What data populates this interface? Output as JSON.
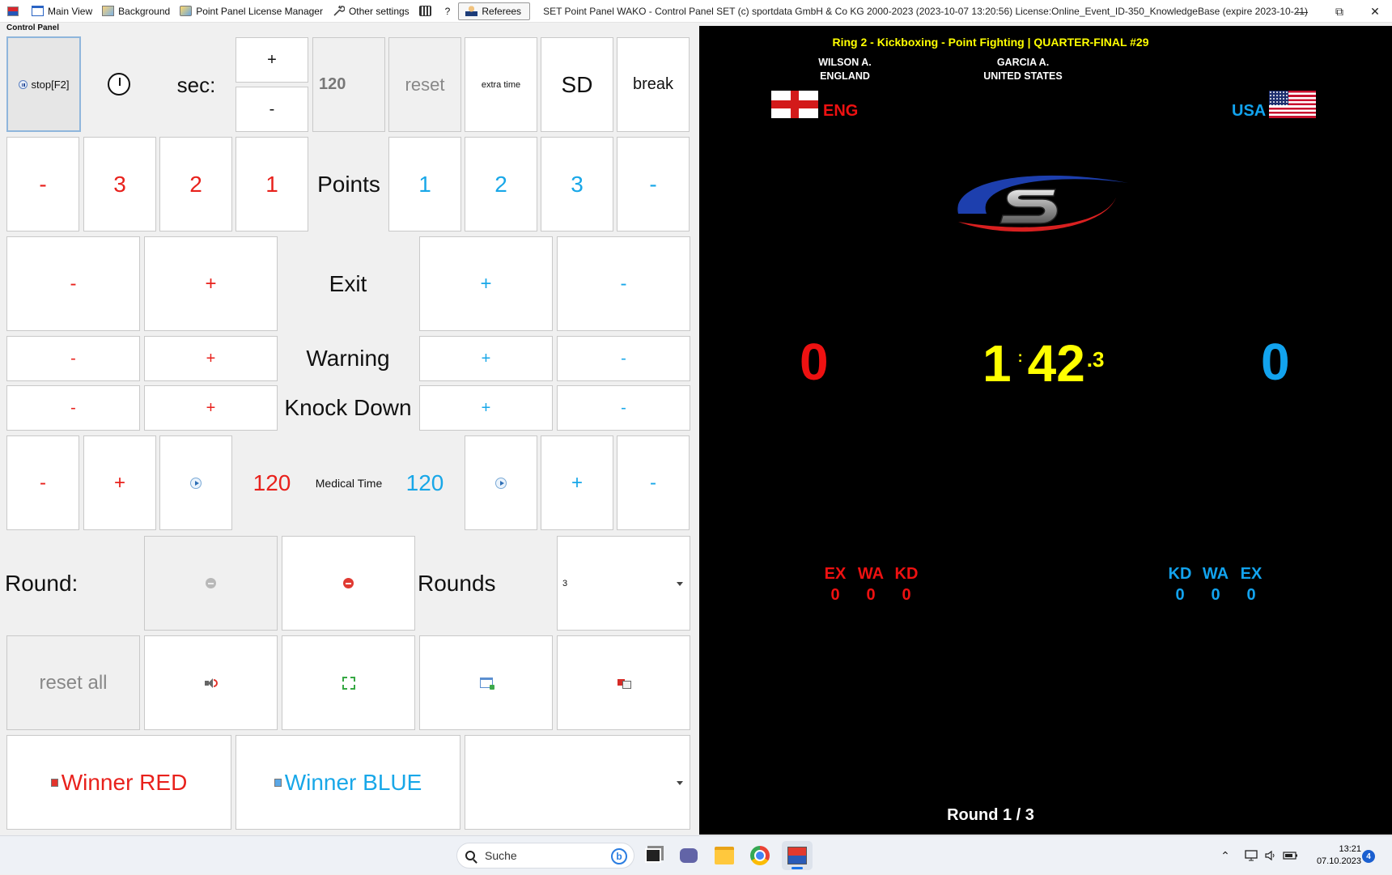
{
  "menu": {
    "items": [
      "Main View",
      "Background",
      "Point Panel License Manager",
      "Other settings"
    ],
    "help": "?",
    "referees": "Referees",
    "window_title": "SET Point Panel WAKO - Control Panel SET (c) sportdata GmbH & Co KG 2000-2023 (2023-10-07 13:20:56) License:Online_Event_ID-350_KnowledgeBase (expire 2023-10-21)",
    "controls": [
      "—",
      "⧉",
      "✕"
    ]
  },
  "control_panel": {
    "label": "Control Panel",
    "timer": {
      "stop": "stop[F2]",
      "sec_label": "sec:",
      "plus": "+",
      "minus": "-",
      "seconds_value": "120",
      "reset": "reset",
      "extra_time": "extra time",
      "sd": "SD",
      "break": "break"
    },
    "points": {
      "label": "Points",
      "red": [
        "-",
        "3",
        "2",
        "1"
      ],
      "blue": [
        "1",
        "2",
        "3",
        "-"
      ]
    },
    "exit": {
      "label": "Exit",
      "red": [
        "-",
        "+"
      ],
      "blue": [
        "+",
        "-"
      ]
    },
    "warning": {
      "label": "Warning",
      "red": [
        "-",
        "+"
      ],
      "blue": [
        "+",
        "-"
      ]
    },
    "knock_down": {
      "label": "Knock Down",
      "red": [
        "-",
        "+"
      ],
      "blue": [
        "+",
        "-"
      ]
    },
    "medical": {
      "label": "Medical Time",
      "red_value": "120",
      "blue_value": "120",
      "red": [
        "-",
        "+"
      ],
      "blue": [
        "+",
        "-"
      ]
    },
    "round": {
      "label": "Round:",
      "rounds_label": "Rounds",
      "rounds_value": "3"
    },
    "reset_all": "reset all",
    "winner_red": "Winner RED",
    "winner_blue": "Winner BLUE",
    "winner_select": ""
  },
  "scoreboard": {
    "title": "Ring 2 - Kickboxing - Point Fighting | QUARTER-FINAL #29",
    "red": {
      "name": "WILSON A.",
      "country": "ENGLAND",
      "code": "ENG",
      "score": "0",
      "ex": "0",
      "wa": "0",
      "kd": "0"
    },
    "blue": {
      "name": "GARCIA A.",
      "country": "UNITED STATES",
      "code": "USA",
      "score": "0",
      "ex": "0",
      "wa": "0",
      "kd": "0"
    },
    "stat_labels": {
      "ex": "EX",
      "wa": "WA",
      "kd": "KD"
    },
    "timer": {
      "minutes": "1",
      "separator": ":",
      "seconds": "42",
      "fraction": ".3"
    },
    "round_text": "Round 1 / 3",
    "colors": {
      "red": "#ee1111",
      "blue": "#12a3ee",
      "yellow": "#ffff00",
      "background": "#000000"
    }
  },
  "taskbar": {
    "search_placeholder": "Suche",
    "time": "13:21",
    "date": "07.10.2023",
    "notifications": "4",
    "apps": [
      "start-icon",
      "search",
      "task-view-icon",
      "teams-icon",
      "file-explorer-icon",
      "chrome-icon",
      "setpointpanel-icon"
    ]
  }
}
